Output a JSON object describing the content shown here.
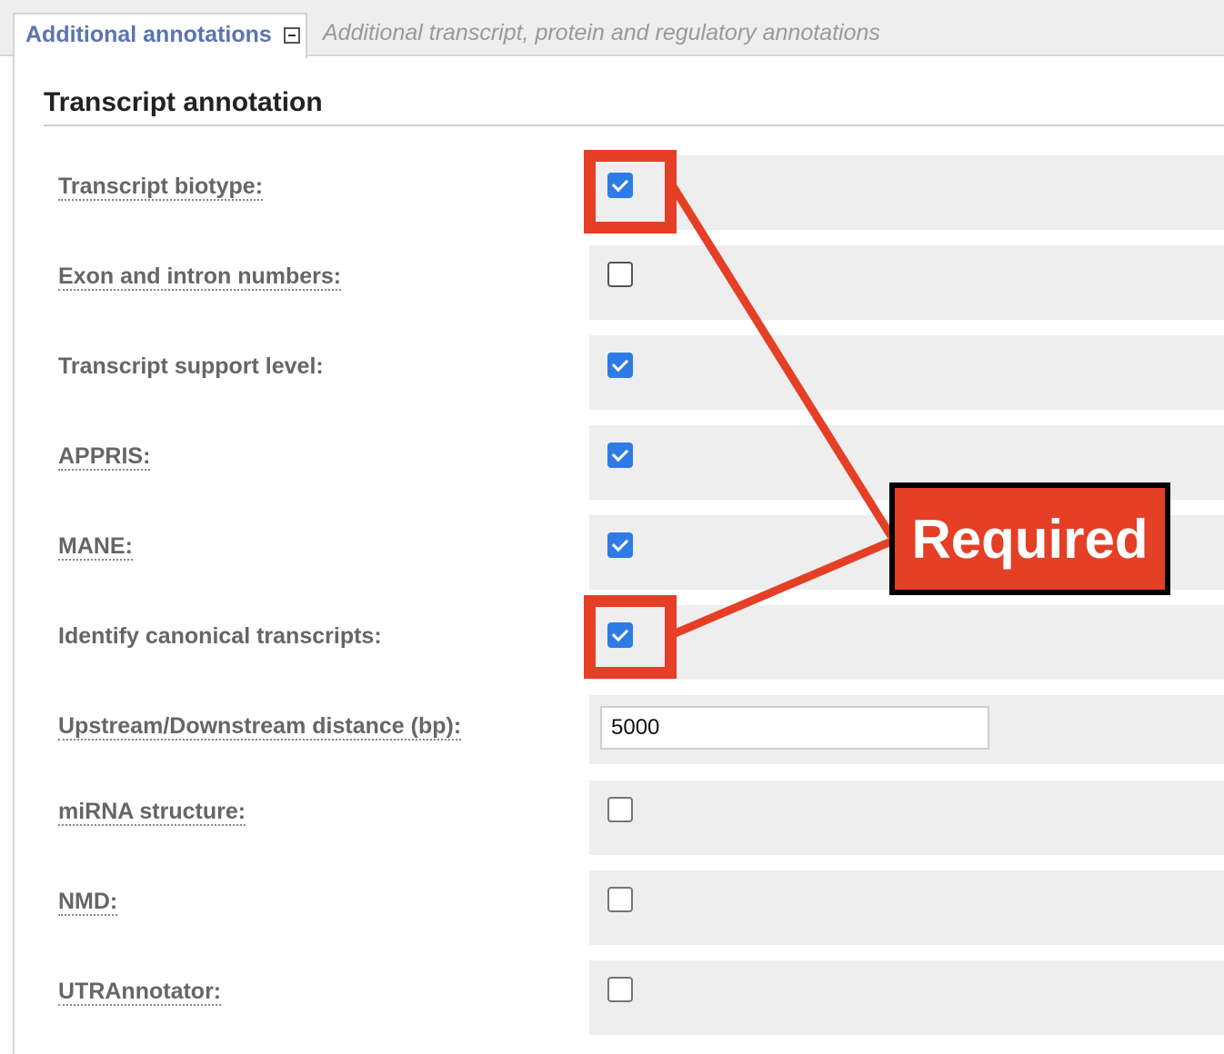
{
  "tabs": {
    "active_label": "Additional annotations",
    "description": "Additional transcript, protein and regulatory annotations"
  },
  "section": {
    "title": "Transcript annotation"
  },
  "fields": {
    "transcript_biotype": {
      "label": "Transcript biotype:",
      "checked": true
    },
    "exon_intron_numbers": {
      "label": "Exon and intron numbers:",
      "checked": false
    },
    "transcript_support_level": {
      "label": "Transcript support level:",
      "checked": true
    },
    "appris": {
      "label": "APPRIS:",
      "checked": true
    },
    "mane": {
      "label": "MANE:",
      "checked": true
    },
    "canonical": {
      "label": "Identify canonical transcripts:",
      "checked": true
    },
    "distance": {
      "label": "Upstream/Downstream distance (bp):",
      "value": "5000"
    },
    "mirna": {
      "label": "miRNA structure:",
      "checked": false
    },
    "nmd": {
      "label": "NMD:",
      "checked": false
    },
    "utrannotator": {
      "label": "UTRAnnotator:",
      "checked": false
    }
  },
  "callout": {
    "text": "Required"
  },
  "colors": {
    "accent": "#e53f26",
    "checkbox": "#2f7be6",
    "tab_label": "#5a73b3"
  }
}
